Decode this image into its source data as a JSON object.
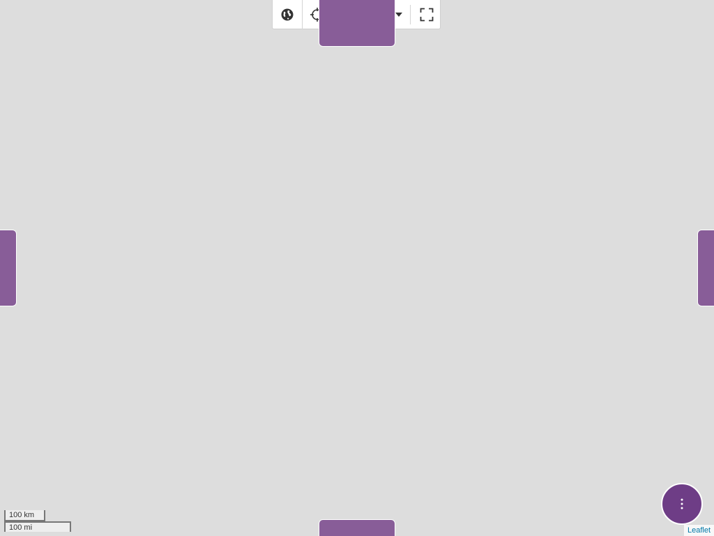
{
  "toolbar": {
    "buttons": [
      {
        "icon": "globe-icon"
      },
      {
        "icon": "crosshair-icon"
      },
      {
        "icon": "search-location-icon"
      },
      {
        "icon": "wrench-icon"
      },
      {
        "icon": "caret-down-icon"
      },
      {
        "icon": "fullscreen-icon"
      }
    ]
  },
  "drawers": {
    "color": "#885d98"
  },
  "fab": {
    "icon": "more-vertical-icon",
    "color": "#6e3d86"
  },
  "scale": {
    "metric": "100 km",
    "imperial": "100 mi"
  },
  "attribution": {
    "link": "Leaflet"
  }
}
